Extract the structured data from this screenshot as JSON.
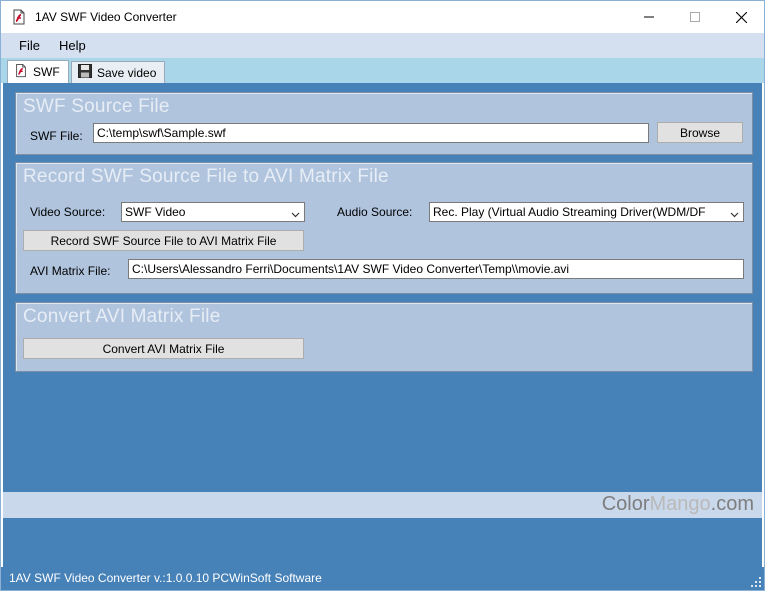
{
  "window": {
    "title": "1AV SWF Video Converter"
  },
  "menu": {
    "file": "File",
    "help": "Help"
  },
  "tabs": [
    {
      "label": "SWF"
    },
    {
      "label": "Save video"
    }
  ],
  "swf_source": {
    "title": "SWF Source File",
    "file_label": "SWF File:",
    "file_value": "C:\\temp\\swf\\Sample.swf",
    "browse_label": "Browse"
  },
  "record": {
    "title": "Record SWF Source File to AVI Matrix File",
    "video_source_label": "Video Source:",
    "video_source_value": "SWF Video",
    "audio_source_label": "Audio Source:",
    "audio_source_value": "Rec. Play (Virtual Audio Streaming Driver(WDM/DF",
    "record_button": "Record SWF Source File to AVI Matrix File",
    "avi_label": "AVI Matrix File:",
    "avi_value": "C:\\Users\\Alessandro Ferri\\Documents\\1AV SWF Video Converter\\Temp\\\\movie.avi"
  },
  "convert": {
    "title": "Convert AVI Matrix File",
    "button": "Convert AVI Matrix File"
  },
  "watermark": {
    "part1": "Color",
    "part2": "Mango",
    "part3": ".com"
  },
  "status": {
    "text": "1AV SWF Video Converter v.:1.0.0.10 PCWinSoft Software"
  },
  "colors": {
    "main_bg": "#4681b8",
    "group_bg": "#b0c4de",
    "menubar_bg": "#d4dff0",
    "tabstrip_bg": "#a9d6e8"
  },
  "icons": {
    "app": "swf-file-icon",
    "tab_swf": "swf-file-icon",
    "tab_save": "floppy-disk-icon",
    "minimize": "minimize-icon",
    "maximize": "maximize-icon",
    "close": "close-icon",
    "dropdown": "chevron-down-icon",
    "grip": "resize-grip-icon"
  }
}
